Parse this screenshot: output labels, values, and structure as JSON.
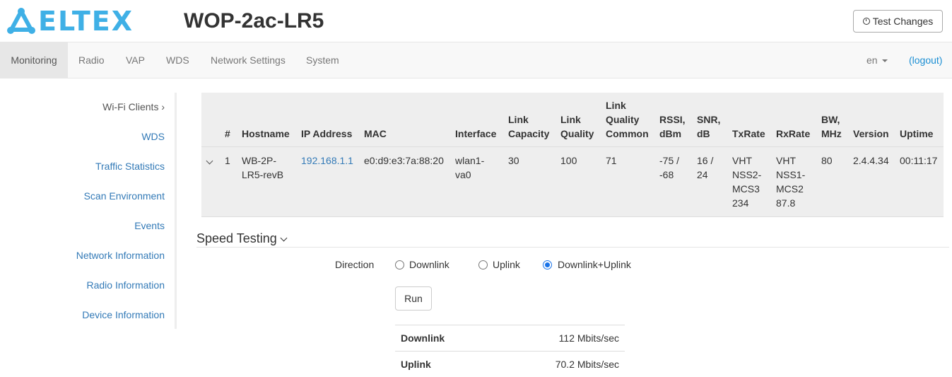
{
  "header": {
    "brand": "ELTEX",
    "device_title": "WOP-2ac-LR5",
    "test_changes_label": "Test Changes"
  },
  "navbar": {
    "tabs": [
      {
        "label": "Monitoring"
      },
      {
        "label": "Radio"
      },
      {
        "label": "VAP"
      },
      {
        "label": "WDS"
      },
      {
        "label": "Network Settings"
      },
      {
        "label": "System"
      }
    ],
    "language": "en",
    "logout_label": "(logout)"
  },
  "sidebar": {
    "items": [
      {
        "label": "Wi-Fi Clients ›"
      },
      {
        "label": "WDS"
      },
      {
        "label": "Traffic Statistics"
      },
      {
        "label": "Scan Environment"
      },
      {
        "label": "Events"
      },
      {
        "label": "Network Information"
      },
      {
        "label": "Radio Information"
      },
      {
        "label": "Device Information"
      }
    ]
  },
  "table": {
    "headers": {
      "num": "#",
      "hostname": "Hostname",
      "ip": "IP Address",
      "mac": "MAC",
      "interface": "Interface",
      "link_capacity": [
        "Link",
        "Capacity"
      ],
      "link_quality": [
        "Link",
        "Quality"
      ],
      "lq_common": [
        "Link",
        "Quality",
        "Common"
      ],
      "rssi": [
        "RSSI,",
        "dBm"
      ],
      "snr": [
        "SNR,",
        "dB"
      ],
      "txrate": "TxRate",
      "rxrate": "RxRate",
      "bw": [
        "BW,",
        "MHz"
      ],
      "version": "Version",
      "uptime": "Uptime"
    },
    "rows": [
      {
        "num": "1",
        "hostname": [
          "WB-2P-",
          "LR5-revB"
        ],
        "ip": "192.168.1.1",
        "mac": "e0:d9:e3:7a:88:20",
        "interface": [
          "wlan1-",
          "va0"
        ],
        "link_capacity": "30",
        "link_quality": "100",
        "lq_common": "71",
        "rssi": [
          "-75 /",
          "-68"
        ],
        "snr": [
          "16 /",
          "24"
        ],
        "txrate": [
          "VHT",
          "NSS2-",
          "MCS3",
          "234"
        ],
        "rxrate": [
          "VHT",
          "NSS1-",
          "MCS2",
          "87.8"
        ],
        "bw": "80",
        "version": "2.4.4.34",
        "uptime": "00:11:17"
      }
    ]
  },
  "speed_testing": {
    "title": "Speed Testing",
    "direction_label": "Direction",
    "options": [
      {
        "label": "Downlink",
        "checked": false
      },
      {
        "label": "Uplink",
        "checked": false
      },
      {
        "label": "Downlink+Uplink",
        "checked": true
      }
    ],
    "run_label": "Run",
    "results": [
      {
        "label": "Downlink",
        "value": "112 Mbits/sec"
      },
      {
        "label": "Uplink",
        "value": "70.2 Mbits/sec"
      }
    ]
  },
  "colors": {
    "brand": "#3fb0e6",
    "link": "#337ab7",
    "radio_checked": "#1a73e8"
  }
}
